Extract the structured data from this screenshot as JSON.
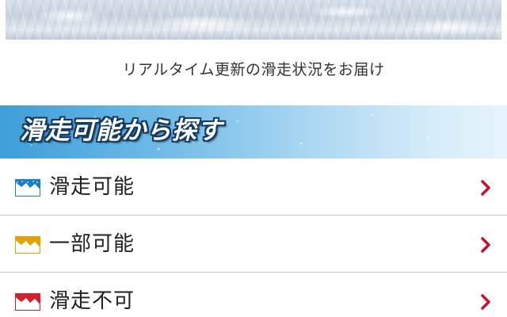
{
  "tagline": "リアルタイム更新の滑走状況をお届け",
  "section": {
    "title": "滑走可能から探す"
  },
  "colors": {
    "header_gradient_start": "#3d9ed8",
    "header_title_outline": "#123a66",
    "chevron": "#c8102e",
    "status_available": "#1a7fc4",
    "status_partial": "#e0a400",
    "status_closed": "#d4202a"
  },
  "status_list": {
    "items": [
      {
        "label": "滑走可能",
        "icon": "mountain-available-icon",
        "color": "#1a7fc4"
      },
      {
        "label": "一部可能",
        "icon": "mountain-partial-icon",
        "color": "#e0a400"
      },
      {
        "label": "滑走不可",
        "icon": "mountain-closed-icon",
        "color": "#d4202a"
      }
    ]
  }
}
